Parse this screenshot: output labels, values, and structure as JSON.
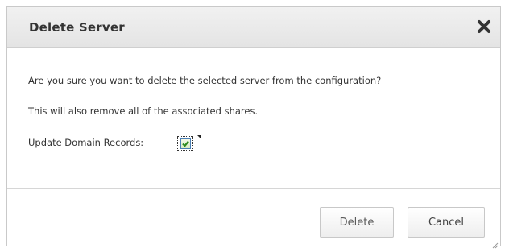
{
  "dialog": {
    "title": "Delete Server",
    "message_line1": "Are you sure you want to delete the selected server from the configuration?",
    "message_line2": "This will also remove all of the associated shares.",
    "update_domain_label": "Update Domain Records:",
    "update_domain_checked": true,
    "buttons": {
      "delete_label": "Delete",
      "cancel_label": "Cancel"
    },
    "icons": {
      "close": "close-icon",
      "check": "checkmark-icon",
      "resize": "resize-grip-icon"
    },
    "colors": {
      "title_bar": "#e8e8e8",
      "check_green": "#2d8a1e",
      "check_border": "#4a7fb5"
    }
  }
}
